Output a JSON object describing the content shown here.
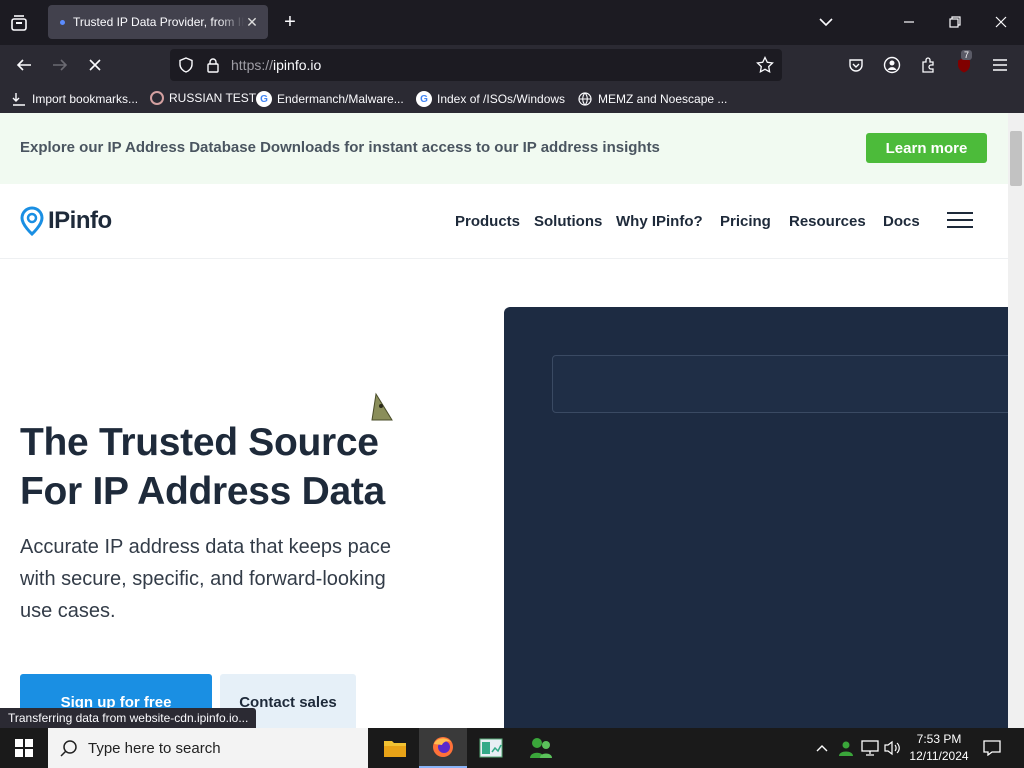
{
  "browser": {
    "tab_title": "Trusted IP Data Provider, from IP",
    "url_scheme": "https://",
    "url_host": "ipinfo.io",
    "extension_badge": "7",
    "status_text": "Transferring data from website-cdn.ipinfo.io..."
  },
  "bookmarks": [
    {
      "label": "Import bookmarks...",
      "icon": "import-icon"
    },
    {
      "label": "RUSSIAN TEST",
      "icon": "site-icon"
    },
    {
      "label": "Endermanch/Malware...",
      "icon": "google-icon"
    },
    {
      "label": "Index of /ISOs/Windows",
      "icon": "google-icon"
    },
    {
      "label": "MEMZ and Noescape ...",
      "icon": "globe-icon"
    }
  ],
  "banner": {
    "text": "Explore our IP Address Database Downloads for instant access to our IP address insights",
    "button": "Learn more"
  },
  "header": {
    "logo": "IPinfo",
    "nav": [
      "Products",
      "Solutions",
      "Why IPinfo?",
      "Pricing",
      "Resources",
      "Docs"
    ]
  },
  "hero": {
    "title_line1": "The Trusted Source",
    "title_line2": "For IP Address Data",
    "subtitle": "Accurate IP address data that keeps pace with secure, specific, and forward-looking use cases.",
    "primary_cta": "Sign up for free",
    "secondary_cta": "Contact sales"
  },
  "taskbar": {
    "search_placeholder": "Type here to search",
    "time": "7:53 PM",
    "date": "12/11/2024"
  },
  "colors": {
    "banner_bg": "#f1faf1",
    "learn_more_bg": "#4cbb3a",
    "signup_bg": "#1a8fe3",
    "demo_panel_bg": "#1d2b42"
  }
}
